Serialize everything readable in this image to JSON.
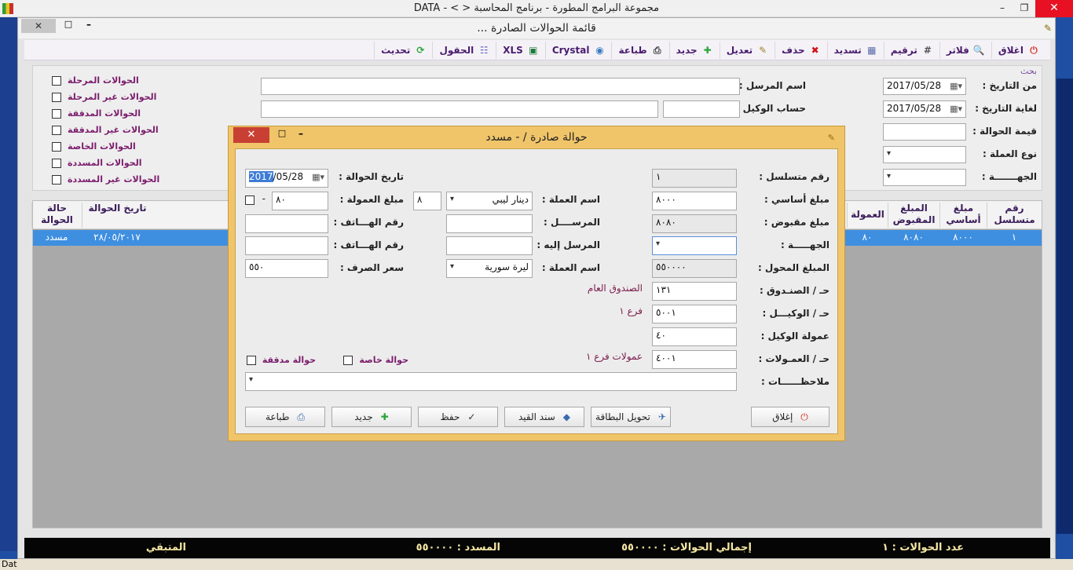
{
  "app": {
    "title": "مجموعة البرامج المطورة - برنامج المحاسبة < > - DATA",
    "min": "–",
    "max": "❐",
    "close": "✕"
  },
  "mdi": {
    "title": "قائمة الحوالات الصادرة ...",
    "close": "✕",
    "max": "□",
    "min": "–",
    "restore_icon": "✎"
  },
  "toolbar": {
    "items": [
      {
        "label": "اغلاق",
        "icon": "power-icon",
        "glyph": "⏻",
        "color": "#d9352b"
      },
      {
        "label": "فلاتر",
        "icon": "filter-search-icon",
        "glyph": "🔍",
        "color": "#2a66c4"
      },
      {
        "label": "ترقيم",
        "icon": "numbering-icon",
        "glyph": "#",
        "color": "#555555"
      },
      {
        "label": "تسديد",
        "icon": "calculator-icon",
        "glyph": "▦",
        "color": "#5a6aa8"
      },
      {
        "label": "حذف",
        "icon": "delete-icon",
        "glyph": "✖",
        "color": "#d0121a"
      },
      {
        "label": "تعديل",
        "icon": "edit-icon",
        "glyph": "✎",
        "color": "#a0822a"
      },
      {
        "label": "جديد",
        "icon": "add-icon",
        "glyph": "✚",
        "color": "#2ba53a"
      },
      {
        "label": "طباعة",
        "icon": "printer-icon",
        "glyph": "⎙",
        "color": "#444444"
      },
      {
        "label": "Crystal",
        "icon": "crystal-icon",
        "glyph": "◉",
        "color": "#3a7abf"
      },
      {
        "label": "XLS",
        "icon": "excel-icon",
        "glyph": "▣",
        "color": "#1e7a3a"
      },
      {
        "label": "الحقول",
        "icon": "fields-icon",
        "glyph": "☷",
        "color": "#6a6ac0"
      },
      {
        "label": "تحديث",
        "icon": "refresh-icon",
        "glyph": "⟳",
        "color": "#2ba53a"
      }
    ]
  },
  "search": {
    "legend": "بحث",
    "from_date_label": "من التاريخ :",
    "from_date": "2017/05/28",
    "to_date_label": "لغاية التاريخ :",
    "to_date": "2017/05/28",
    "amount_label": "قيمة الحوالة :",
    "currency_label": "نوع العملة :",
    "party_label": "الجهـــــــة :",
    "sender_label": "اسم المرسل :",
    "agent_account_label": "حساب الوكيل :",
    "checkboxes": [
      "الحوالات المرحلة",
      "الحوالات غير المرحلة",
      "الحوالات المدققة",
      "الحوالات غير المدققة",
      "الحوالات الخاصة",
      "الحوالات المسددة",
      "الحوالات غير المسددة"
    ]
  },
  "grid": {
    "headers": {
      "serial": "رقم متسلسل",
      "basic": "مبلغ أساسي",
      "received": "المبلغ المقبوض",
      "commission": "العمولة",
      "date": "تاريخ الحوالة",
      "status": "حالة الحوالة"
    },
    "rows": [
      {
        "serial": "١",
        "basic": "٨٠٠٠",
        "received": "٨٠٨٠",
        "commission": "٨٠",
        "date": "٢٨/٠٥/٢٠١٧",
        "status": "مسدد"
      }
    ]
  },
  "status": {
    "count": "عدد الحوالات : ١",
    "total": "إجمالي الحوالات : ٥٥٠٠٠٠",
    "paid": "المسدد : ٥٥٠٠٠٠",
    "remaining": "المتبقي"
  },
  "taskbar": {
    "label": "Dat"
  },
  "dialog": {
    "title": "حوالة صادرة / - مسدد",
    "close": "✕",
    "max": "□",
    "min": "–",
    "restore_icon": "✎",
    "serial_label": "رقم متسلسل :",
    "serial": "١",
    "basic_label": "مبلغ أساسي :",
    "basic": "٨٠٠٠",
    "received_label": "مبلغ مقبوض :",
    "received": "٨٠٨٠",
    "party_label": "الجهـــــة :",
    "transferred_label": "المبلغ المحول :",
    "transferred": "٥٥٠٠٠٠",
    "fund_label": "حـ / الصنـدوق :",
    "fund": "١٣١",
    "fund_name": "الصندوق العام",
    "agent_label": "حـ / الوكيـــل :",
    "agent": "٥٠٠١",
    "agent_name": "فرع ١",
    "agent_comm_label": "عمولة الوكيل :",
    "agent_comm": "٤٠",
    "comms_label": "حـ / العمـولات :",
    "comms": "٤٠٠١",
    "comms_name": "عمولات فرع ١",
    "notes_label": "ملاحظــــــات :",
    "currency_label": "اسم العملة :",
    "currency": "دينار ليبي",
    "currency_rate": "٨",
    "sender_label": "المرســــل :",
    "recipient_label": "المرسل إليه :",
    "currency2_label": "اسم العملة :",
    "currency2": "ليرة سورية",
    "date_label": "تاريخ الحوالة :",
    "date_sel": "2017",
    "date_rest": "/05/28",
    "comm_amount_label": "مبلغ العمولة :",
    "comm_amount": "٨٠",
    "comm_dash": "-",
    "phone1_label": "رقم الهـــاتف :",
    "phone2_label": "رقم الهـــاتف :",
    "rate_label": "سعر الصرف :",
    "rate": "٥٥٠",
    "audited_label": "حوالة مدققة",
    "private_label": "حوالة خاصة",
    "buttons": {
      "close": "إغلاق",
      "convert": "تحويل البطاقة",
      "voucher": "سند القيد",
      "save": "حفظ",
      "new": "جديد",
      "print": "طباعة"
    }
  }
}
